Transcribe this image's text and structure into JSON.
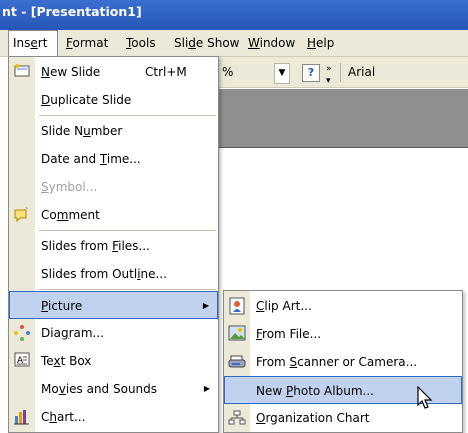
{
  "title": "nt - [Presentation1]",
  "menubar": [
    {
      "label": "Insert",
      "key": "n",
      "open": true
    },
    {
      "label": "Format",
      "key": "o"
    },
    {
      "label": "Tools",
      "key": "T"
    },
    {
      "label": "Slide Show",
      "key": "d"
    },
    {
      "label": "Window",
      "key": "W"
    },
    {
      "label": "Help",
      "key": "H"
    }
  ],
  "toolbar": {
    "percent": "%",
    "font": "Arial"
  },
  "insert_menu": [
    {
      "label": "New Slide",
      "shortcut": "Ctrl+M",
      "icon": "new-slide-icon"
    },
    {
      "label": "Duplicate Slide"
    },
    {
      "label": "Slide Number"
    },
    {
      "label": "Date and Time..."
    },
    {
      "label": "Symbol...",
      "disabled": true
    },
    {
      "label": "Comment",
      "icon": "comment-icon"
    },
    {
      "label": "Slides from Files..."
    },
    {
      "label": "Slides from Outline..."
    },
    {
      "label": "Picture",
      "submenu": true,
      "highlighted": true
    },
    {
      "label": "Diagram...",
      "icon": "diagram-icon"
    },
    {
      "label": "Text Box",
      "icon": "text-box-icon"
    },
    {
      "label": "Movies and Sounds",
      "submenu": true
    },
    {
      "label": "Chart...",
      "icon": "chart-icon"
    }
  ],
  "picture_menu": [
    {
      "label": "Clip Art...",
      "icon": "clip-art-icon"
    },
    {
      "label": "From File...",
      "icon": "from-file-icon"
    },
    {
      "label": "From Scanner or Camera...",
      "icon": "scanner-icon"
    },
    {
      "label": "New Photo Album...",
      "highlighted": true
    },
    {
      "label": "Organization Chart",
      "icon": "org-chart-icon"
    }
  ]
}
